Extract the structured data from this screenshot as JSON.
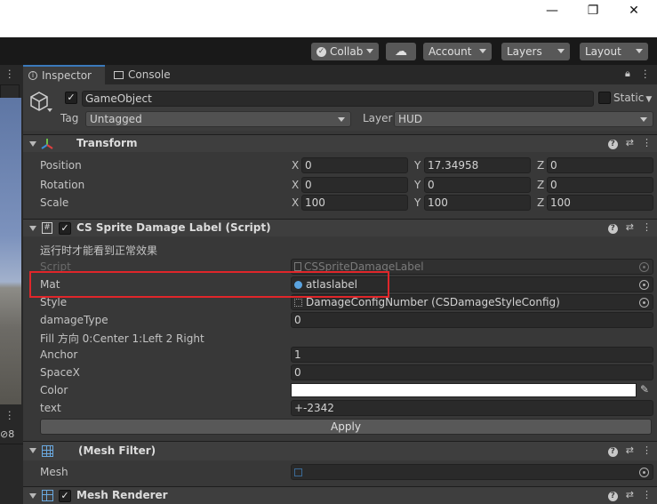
{
  "window": {
    "minimize_glyph": "—",
    "maximize_glyph": "❐",
    "close_glyph": "✕"
  },
  "toolbar": {
    "collab": "Collab",
    "account": "Account",
    "layers": "Layers",
    "layout": "Layout"
  },
  "left_panel": {
    "badge": "8"
  },
  "tabs": {
    "inspector": "Inspector",
    "console": "Console"
  },
  "game_object": {
    "name": "GameObject",
    "static_label": "Static",
    "tag_label": "Tag",
    "tag_value": "Untagged",
    "layer_label": "Layer",
    "layer_value": "HUD"
  },
  "transform": {
    "title": "Transform",
    "position_label": "Position",
    "rotation_label": "Rotation",
    "scale_label": "Scale",
    "axis_x": "X",
    "axis_y": "Y",
    "axis_z": "Z",
    "position": {
      "x": "0",
      "y": "17.34958",
      "z": "0"
    },
    "rotation": {
      "x": "0",
      "y": "0",
      "z": "0"
    },
    "scale": {
      "x": "100",
      "y": "100",
      "z": "100"
    }
  },
  "script_component": {
    "title": "CS Sprite Damage Label (Script)",
    "note": "运行时才能看到正常效果",
    "script_label": "Script",
    "script_value": "CSSpriteDamageLabel",
    "mat_label": "Mat",
    "mat_value": "atlaslabel",
    "style_label": "Style",
    "style_value": "DamageConfigNumber (CSDamageStyleConfig)",
    "damage_type_label": "damageType",
    "damage_type_value": "0",
    "fill_note": "Fill 方向 0:Center 1:Left 2 Right",
    "anchor_label": "Anchor",
    "anchor_value": "1",
    "spacex_label": "SpaceX",
    "spacex_value": "0",
    "color_label": "Color",
    "color_value": "#ffffff",
    "text_label": "text",
    "text_value": "+-2342",
    "apply_label": "Apply"
  },
  "mesh_filter": {
    "title": "(Mesh Filter)",
    "mesh_label": "Mesh"
  },
  "mesh_renderer": {
    "title": "Mesh Renderer"
  },
  "colors": {
    "highlight": "#e0262a",
    "accent": "#3a79bb"
  }
}
